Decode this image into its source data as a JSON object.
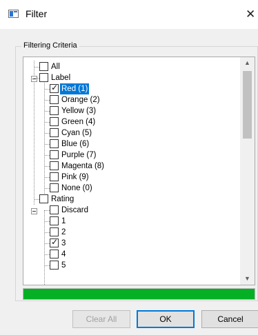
{
  "window": {
    "title": "Filter",
    "close_glyph": "✕",
    "icon": "filter-window-icon"
  },
  "group": {
    "label": "Filtering Criteria"
  },
  "tree": {
    "items": [
      {
        "label": "All",
        "checked": false,
        "level": 0
      },
      {
        "label": "Label",
        "checked": false,
        "level": 0,
        "expanded": true
      },
      {
        "label": "Red (1)",
        "checked": true,
        "level": 1,
        "selected": true
      },
      {
        "label": "Orange (2)",
        "checked": false,
        "level": 1
      },
      {
        "label": "Yellow (3)",
        "checked": false,
        "level": 1
      },
      {
        "label": "Green (4)",
        "checked": false,
        "level": 1
      },
      {
        "label": "Cyan (5)",
        "checked": false,
        "level": 1
      },
      {
        "label": "Blue (6)",
        "checked": false,
        "level": 1
      },
      {
        "label": "Purple (7)",
        "checked": false,
        "level": 1
      },
      {
        "label": "Magenta (8)",
        "checked": false,
        "level": 1
      },
      {
        "label": "Pink (9)",
        "checked": false,
        "level": 1
      },
      {
        "label": "None (0)",
        "checked": false,
        "level": 1
      },
      {
        "label": "Rating",
        "checked": false,
        "level": 0,
        "expanded": true
      },
      {
        "label": "Discard",
        "checked": false,
        "level": 1
      },
      {
        "label": "1",
        "checked": false,
        "level": 1
      },
      {
        "label": "2",
        "checked": false,
        "level": 1
      },
      {
        "label": "3",
        "checked": true,
        "level": 1
      },
      {
        "label": "4",
        "checked": false,
        "level": 1
      },
      {
        "label": "5",
        "checked": false,
        "level": 1
      }
    ]
  },
  "progress": {
    "fraction": 1.0,
    "color": "#06b025"
  },
  "buttons": {
    "clear_all": "Clear All",
    "ok": "OK",
    "cancel": "Cancel"
  },
  "colors": {
    "selection": "#0078d7"
  }
}
